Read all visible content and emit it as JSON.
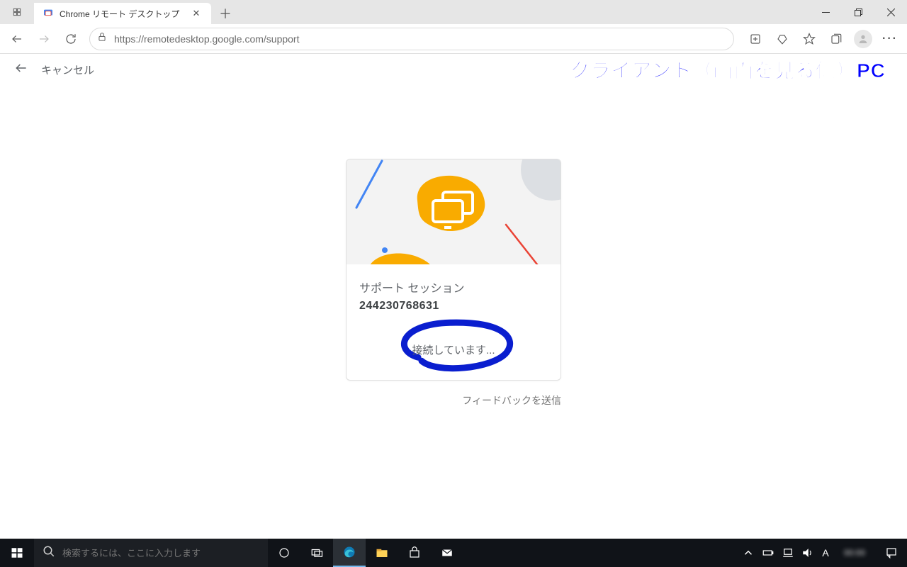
{
  "window": {
    "tab_title": "Chrome リモート デスクトップ"
  },
  "browser": {
    "url": "https://remotedesktop.google.com/support"
  },
  "annotations": {
    "overlay_label": "クライアント（画面を見る側）PC"
  },
  "app_header": {
    "cancel_label": "キャンセル"
  },
  "card": {
    "session_label": "サポート セッション",
    "session_code": "244230768631",
    "connecting_text": "接続しています..."
  },
  "feedback_link": "フィードバックを送信",
  "taskbar": {
    "search_placeholder": "検索するには、ここに入力します",
    "ime_indicator": "A"
  },
  "colors": {
    "google_yellow": "#f9ab00",
    "google_blue": "#4285f4",
    "google_red": "#ea4335",
    "annotation_blue": "#0000ff"
  }
}
